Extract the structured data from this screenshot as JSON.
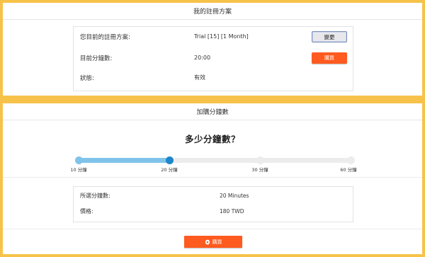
{
  "plan_panel": {
    "title": "我的註冊方案",
    "rows": [
      {
        "label": "您目前的註冊方案:",
        "value": "Trial [15] [1 Month]"
      },
      {
        "label": "目前分鐘數:",
        "value": "20:00"
      },
      {
        "label": "狀態:",
        "value": "有效"
      }
    ],
    "change_button": "變更",
    "buy_button": "購買"
  },
  "buy_panel": {
    "title": "加購分鐘數",
    "question": "多少分鐘數？",
    "slider": {
      "options": [
        "10 分鐘",
        "20 分鐘",
        "30 分鐘",
        "60 分鐘"
      ],
      "selected_index": 1,
      "fill_color": "#7fc3ea",
      "handle_color": "#1f86c9"
    },
    "summary": [
      {
        "label": "所選分鐘數:",
        "value": "20 Minutes"
      },
      {
        "label": "價格:",
        "value": "180 TWD"
      }
    ],
    "buy_button": "購買",
    "buy_button_icon": "gear-icon",
    "accent_color": "#ff5a1f"
  }
}
